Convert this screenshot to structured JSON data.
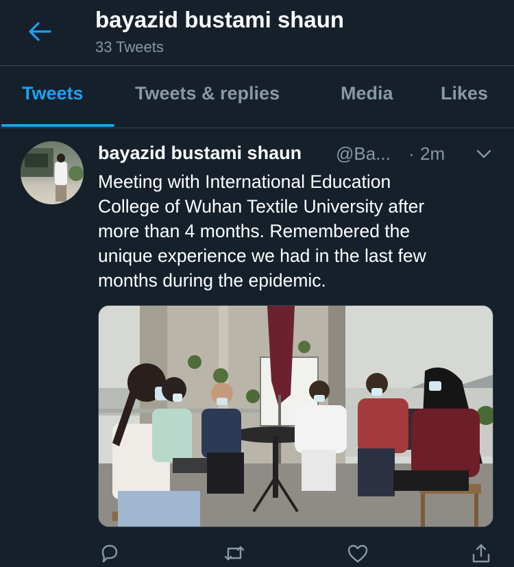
{
  "header": {
    "title": "bayazid bustami shaun",
    "subtitle": "33 Tweets",
    "back_icon": "arrow-left-icon"
  },
  "tabs": [
    {
      "label": "Tweets",
      "active": true
    },
    {
      "label": "Tweets & replies",
      "active": false
    },
    {
      "label": "Media",
      "active": false
    },
    {
      "label": "Likes",
      "active": false
    }
  ],
  "tweet": {
    "author_name": "bayazid bustami shaun",
    "handle": "@Ba...",
    "separator": "·",
    "time": "2m",
    "text_lines": [
      "Meeting with International Education",
      "College of Wuhan Textile University after",
      "more than 4 months. Remembered the",
      "unique experience we had in the last few",
      "months during the epidemic."
    ],
    "actions": [
      {
        "name": "reply-icon"
      },
      {
        "name": "retweet-icon"
      },
      {
        "name": "like-icon"
      },
      {
        "name": "share-icon"
      }
    ]
  },
  "colors": {
    "background": "#15202b",
    "accent": "#1da1f2",
    "secondary_text": "#8899a6",
    "divider": "#38444d"
  }
}
